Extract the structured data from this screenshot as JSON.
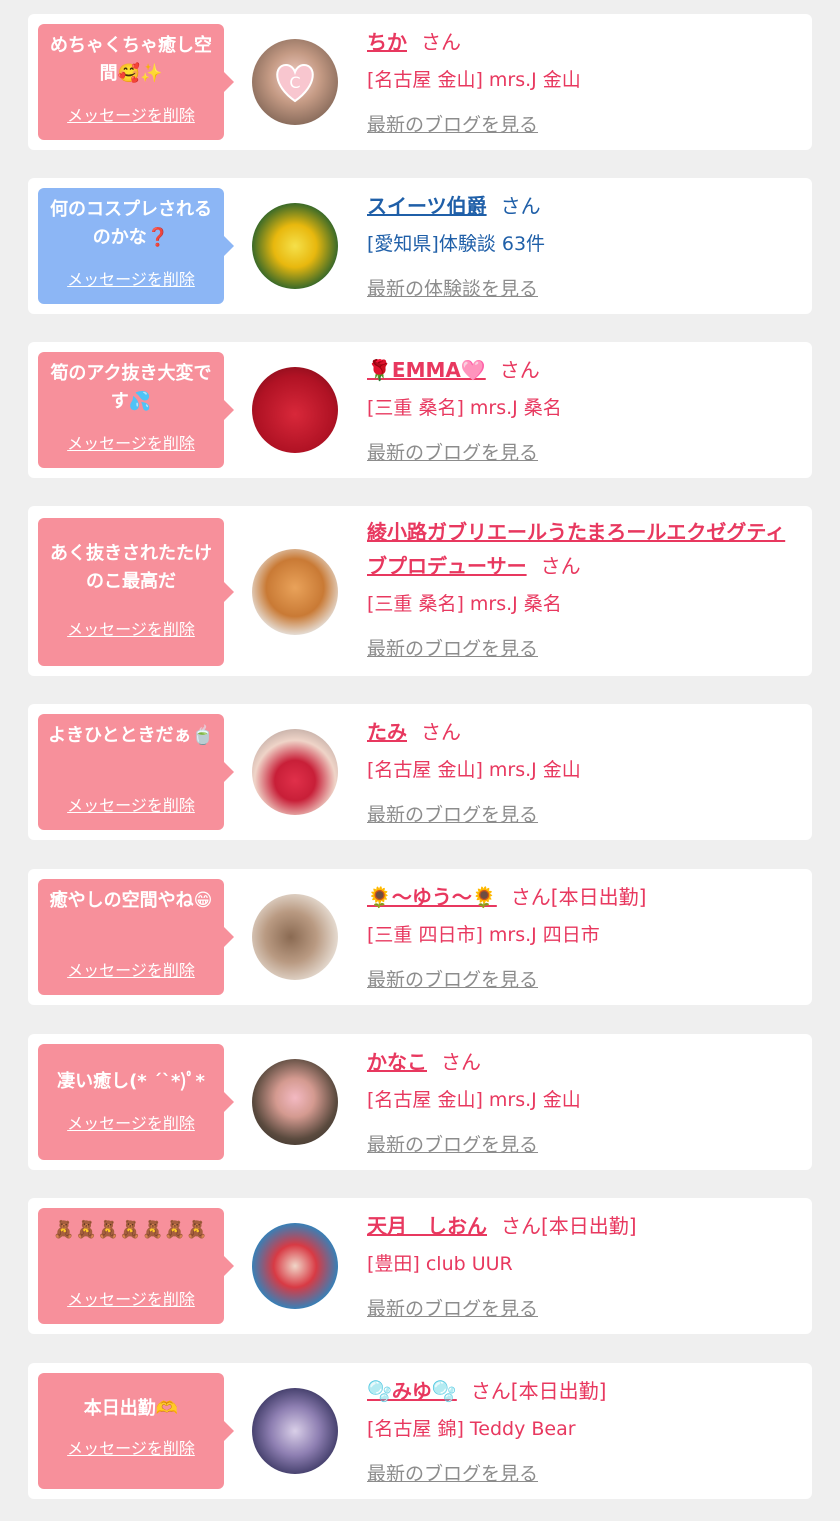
{
  "colors": {
    "pink": "#f7909b",
    "blue": "#8cb6f5",
    "name_pink": "#e8385f",
    "name_blue": "#1f5fa8",
    "gray_link": "#8c8c8c",
    "background": "#efefef"
  },
  "items": [
    {
      "message": "めちゃくちゃ癒し空間🥰✨",
      "delete": "メッセージを削除",
      "name": "ちか",
      "suffix": "さん",
      "shop": "[名古屋 金山] mrs.J 金山",
      "link": "最新のブログを見る",
      "avatar": "user-photo"
    },
    {
      "message": "何のコスプレされるのかな❓",
      "delete": "メッセージを削除",
      "name": "スイーツ伯爵",
      "suffix": "さん",
      "shop": "[愛知県]体験談 63件",
      "link": "最新の体験談を見る",
      "avatar": "yellow-flower-photo"
    },
    {
      "message": "筍のアク抜き大変です💦",
      "delete": "メッセージを削除",
      "name": "🌹EMMA🩷",
      "suffix": "さん",
      "shop": "[三重 桑名] mrs.J 桑名",
      "link": "最新のブログを見る",
      "avatar": "red-shirt-photo"
    },
    {
      "message": "あく抜きされたたけのこ最高だ",
      "delete": "メッセージを削除",
      "name": "綾小路ガブリエールうたまろールエクゼグティブプロデューサー",
      "suffix": "さん",
      "shop": "[三重 桑名] mrs.J 桑名",
      "link": "最新のブログを見る",
      "avatar": "cat-photo"
    },
    {
      "message": "よきひとときだぁ🍵",
      "delete": "メッセージを削除",
      "name": "たみ",
      "suffix": "さん",
      "shop": "[名古屋 金山] mrs.J 金山",
      "link": "最新のブログを見る",
      "avatar": "strawberry-photo"
    },
    {
      "message": "癒やしの空間やね😁",
      "delete": "メッセージを削除",
      "name": "🌻〜ゆう〜🌻",
      "suffix": "さん[本日出勤]",
      "shop": "[三重 四日市] mrs.J 四日市",
      "link": "最新のブログを見る",
      "avatar": "hair-photo"
    },
    {
      "message": "凄い癒し(* ´`*)ﾟ*",
      "delete": "メッセージを削除",
      "name": "かなこ",
      "suffix": "さん",
      "shop": "[名古屋 金山] mrs.J 金山",
      "link": "最新のブログを見る",
      "avatar": "woman-photo"
    },
    {
      "message": "🧸🧸🧸🧸🧸🧸🧸",
      "delete": "メッセージを削除",
      "name": "天月　しおん",
      "suffix": "さん[本日出勤]",
      "shop": "[豊田] club UUR",
      "link": "最新のブログを見る",
      "avatar": "red-dress-photo"
    },
    {
      "message": "本日出勤🫶",
      "delete": "メッセージを削除",
      "name": "🫧みゆ🫧",
      "suffix": "さん[本日出勤]",
      "shop": "[名古屋 錦] Teddy Bear",
      "link": "最新のブログを見る",
      "avatar": "blurred-photo"
    }
  ]
}
